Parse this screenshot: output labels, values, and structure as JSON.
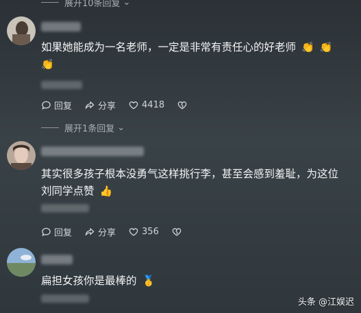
{
  "top_expand": {
    "label": "展开10条回复"
  },
  "comments": [
    {
      "text_line1": "如果她能成为一名老师，一定是非常有责任心的好老师",
      "emoji": "👏",
      "actions": {
        "reply": "回复",
        "share": "分享",
        "likes": "4418"
      }
    },
    {
      "expand_label": "展开1条回复",
      "text_line1": "其实很多孩子根本没勇气这样挑行李，甚至会感到羞耻，为这位",
      "text_line2": "刘同学点赞",
      "emoji": "👍",
      "actions": {
        "reply": "回复",
        "share": "分享",
        "likes": "356"
      }
    },
    {
      "text_line1": "扁担女孩你是最棒的",
      "emoji": "🥇"
    }
  ],
  "watermark": {
    "label": "头条 @江娱迟"
  },
  "colors": {
    "background": "#343c41",
    "text": "#f2f4f5",
    "muted": "#a9b0b4"
  }
}
